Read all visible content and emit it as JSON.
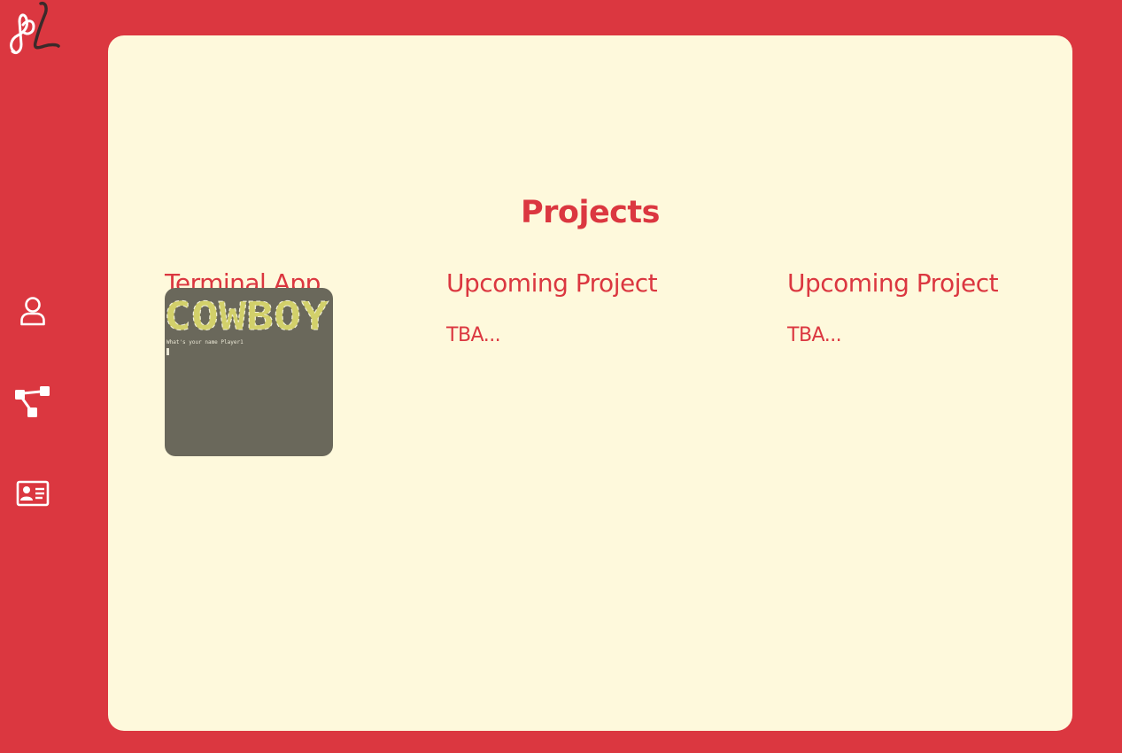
{
  "logo": {
    "monogram": "pL"
  },
  "nav": {
    "items": [
      {
        "icon": "user-icon"
      },
      {
        "icon": "sitemap-icon"
      },
      {
        "icon": "contact-card-icon"
      }
    ]
  },
  "main": {
    "title": "Projects",
    "projects": [
      {
        "title": "Terminal App",
        "thumbnail": {
          "banner_text": "COWBOY",
          "prompt": "What's your name  Player1"
        }
      },
      {
        "title": "Upcoming Project",
        "description": "TBA..."
      },
      {
        "title": "Upcoming Project",
        "description": "TBA..."
      }
    ]
  },
  "colors": {
    "accent": "#db3740",
    "panel_background": "#fef9dc",
    "thumbnail_background": "#6a685b",
    "banner_text": "#d2d06a"
  }
}
